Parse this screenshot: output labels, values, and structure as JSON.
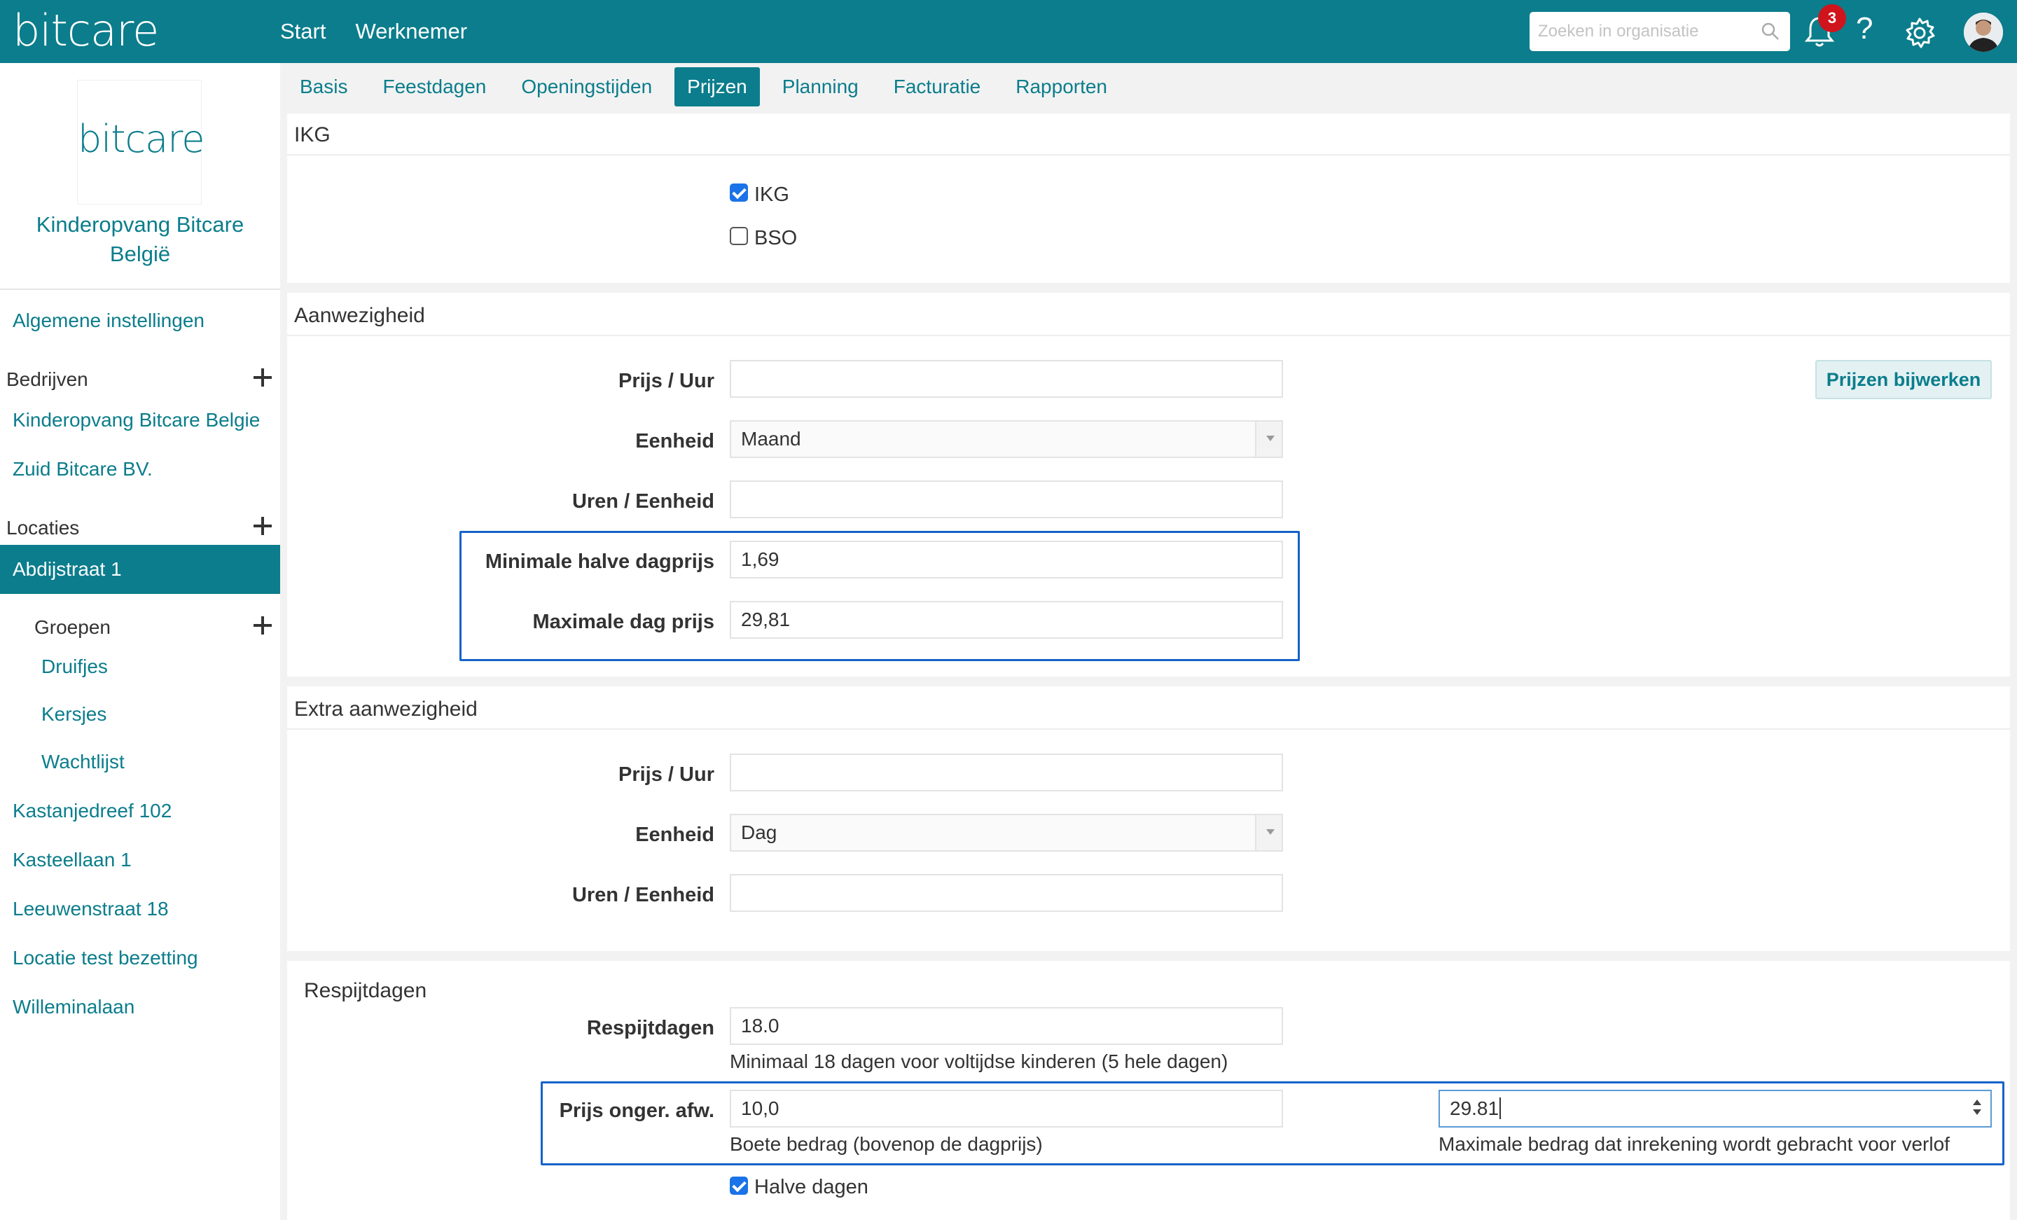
{
  "header": {
    "logo": "bitcare",
    "nav": [
      "Start",
      "Werknemer"
    ],
    "search_placeholder": "Zoeken in organisatie",
    "notification_count": "3",
    "help": "?",
    "brand_color": "#0b7d8c"
  },
  "sidebar": {
    "logo": "bitcare",
    "org_name_line1": "Kinderopvang Bitcare",
    "org_name_line2": "België",
    "general_settings": "Algemene instellingen",
    "companies_header": "Bedrijven",
    "companies": [
      "Kinderopvang Bitcare Belgie",
      "Zuid Bitcare BV."
    ],
    "locations_header": "Locaties",
    "active_location": "Abdijstraat 1",
    "groups_header": "Groepen",
    "groups": [
      "Druifjes",
      "Kersjes",
      "Wachtlijst"
    ],
    "other_locations": [
      "Kastanjedreef 102",
      "Kasteellaan 1",
      "Leeuwenstraat 18",
      "Locatie test bezetting",
      "Willeminalaan"
    ]
  },
  "tabs": [
    "Basis",
    "Feestdagen",
    "Openingstijden",
    "Prijzen",
    "Planning",
    "Facturatie",
    "Rapporten"
  ],
  "active_tab": "Prijzen",
  "ikg_panel": {
    "title": "IKG",
    "options": [
      {
        "label": "IKG",
        "checked": true
      },
      {
        "label": "BSO",
        "checked": false
      }
    ]
  },
  "aanwezigheid": {
    "title": "Aanwezigheid",
    "update_button": "Prijzen bijwerken",
    "prijs_uur_label": "Prijs / Uur",
    "prijs_uur_value": "",
    "eenheid_label": "Eenheid",
    "eenheid_value": "Maand",
    "uren_label": "Uren / Eenheid",
    "uren_value": "",
    "min_halve_label": "Minimale halve dagprijs",
    "min_halve_value": "1,69",
    "max_dag_label": "Maximale dag prijs",
    "max_dag_value": "29,81"
  },
  "extra": {
    "title": "Extra aanwezigheid",
    "prijs_uur_label": "Prijs / Uur",
    "prijs_uur_value": "",
    "eenheid_label": "Eenheid",
    "eenheid_value": "Dag",
    "uren_label": "Uren / Eenheid",
    "uren_value": ""
  },
  "respijt": {
    "title": "Respijtdagen",
    "respijt_label": "Respijtdagen",
    "respijt_value": "18.0",
    "respijt_hint": "Minimaal 18 dagen voor voltijdse kinderen (5 hele dagen)",
    "prijs_label": "Prijs onger. afw.",
    "prijs_value": "10,0",
    "prijs_hint": "Boete bedrag (bovenop de dagprijs)",
    "max_value": "29.81",
    "max_hint": "Maximale bedrag dat inrekening wordt gebracht voor verlof",
    "halve_dagen_label": "Halve dagen",
    "halve_dagen_checked": true
  }
}
